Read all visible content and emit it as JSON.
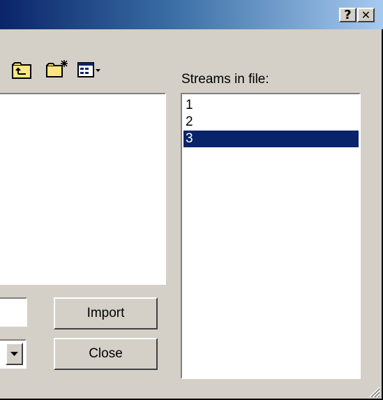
{
  "window": {
    "help_button": "?",
    "close_button": "✕"
  },
  "toolbar": {
    "icons": [
      "up-one-level-icon",
      "create-new-folder-icon",
      "view-menu-icon"
    ]
  },
  "streams": {
    "label": "Streams in file:",
    "items": [
      "1",
      "2",
      "3"
    ],
    "selected_index": 2
  },
  "buttons": {
    "import_label": "Import",
    "close_label": "Close"
  },
  "colors": {
    "selection": "#0a246a",
    "face": "#d4d0c8"
  }
}
